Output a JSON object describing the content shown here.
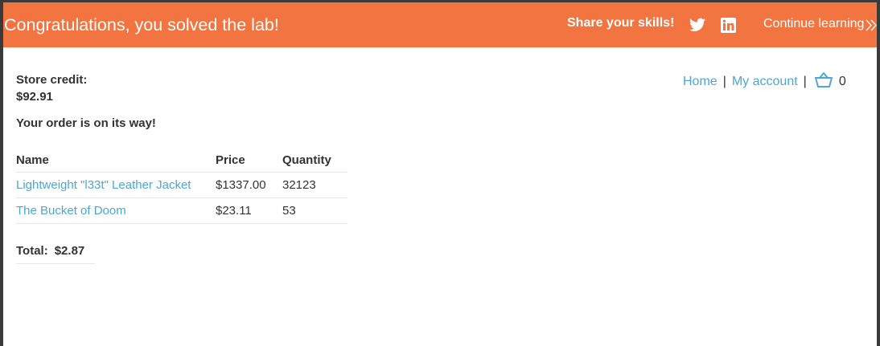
{
  "banner": {
    "title": "Congratulations, you solved the lab!",
    "share_label": "Share your skills!",
    "twitter_icon": "twitter-icon",
    "linkedin_icon": "linkedin-icon",
    "continue_label": "Continue learning",
    "color": "#f27440"
  },
  "nav": {
    "home": "Home",
    "separator": "|",
    "account": "My account",
    "cart_count": "0"
  },
  "store": {
    "credit_label": "Store credit:",
    "credit_value": "$92.91",
    "order_message": "Your order is on its way!"
  },
  "table": {
    "headers": [
      "Name",
      "Price",
      "Quantity"
    ],
    "rows": [
      {
        "name": "Lightweight \"l33t\" Leather Jacket",
        "price": "$1337.00",
        "quantity": "32123"
      },
      {
        "name": "The Bucket of Doom",
        "price": "$23.11",
        "quantity": "53"
      }
    ]
  },
  "total": {
    "label": "Total:",
    "value": "$2.87"
  },
  "colors": {
    "link": "#4da6d6",
    "text": "#333332"
  }
}
